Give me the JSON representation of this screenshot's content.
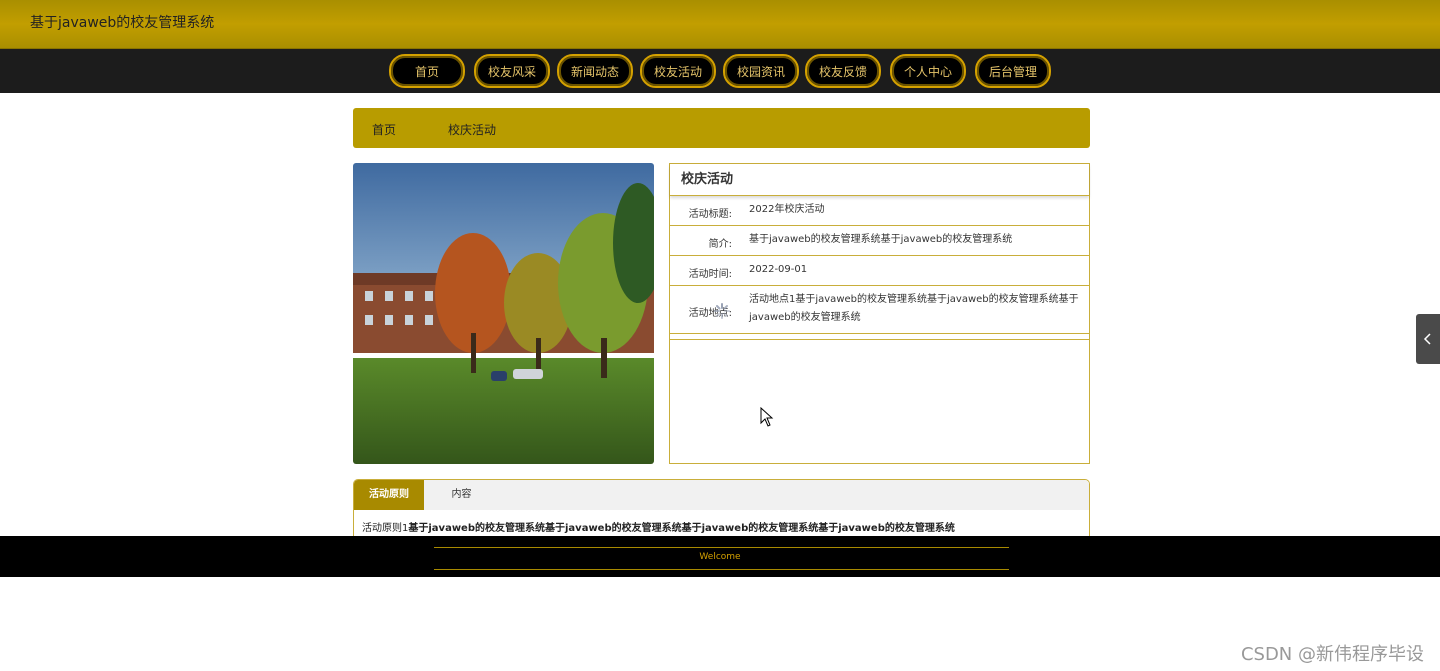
{
  "header": {
    "title": "基于javaweb的校友管理系统"
  },
  "nav": {
    "items": [
      {
        "label": "首页"
      },
      {
        "label": "校友风采"
      },
      {
        "label": "新闻动态"
      },
      {
        "label": "校友活动"
      },
      {
        "label": "校园资讯"
      },
      {
        "label": "校友反馈"
      },
      {
        "label": "个人中心"
      },
      {
        "label": "后台管理"
      }
    ]
  },
  "breadcrumb": {
    "home": "首页",
    "current": "校庆活动"
  },
  "detail": {
    "panel_title": "校庆活动",
    "fields": [
      {
        "label": "活动标题:",
        "value": "2022年校庆活动"
      },
      {
        "label": "简介:",
        "value": "基于javaweb的校友管理系统基于javaweb的校友管理系统"
      },
      {
        "label": "活动时间:",
        "value": "2022-09-01"
      },
      {
        "label": "活动地点:",
        "value": "活动地点1基于javaweb的校友管理系统基于javaweb的校友管理系统基于javaweb的校友管理系统"
      }
    ]
  },
  "tabs": {
    "items": [
      {
        "label": "活动原则"
      },
      {
        "label": "内容"
      }
    ],
    "content_prefix": "活动原则1",
    "content_bold": "基于javaweb的校友管理系统基于javaweb的校友管理系统基于javaweb的校友管理系统基于javaweb的校友管理系统"
  },
  "footer": {
    "text": "Welcome"
  },
  "watermark": "CSDN @新伟程序毕设",
  "colors": {
    "accent": "#b89c00",
    "nav_bg": "#1c1c1c",
    "footer_bg": "#000000"
  }
}
